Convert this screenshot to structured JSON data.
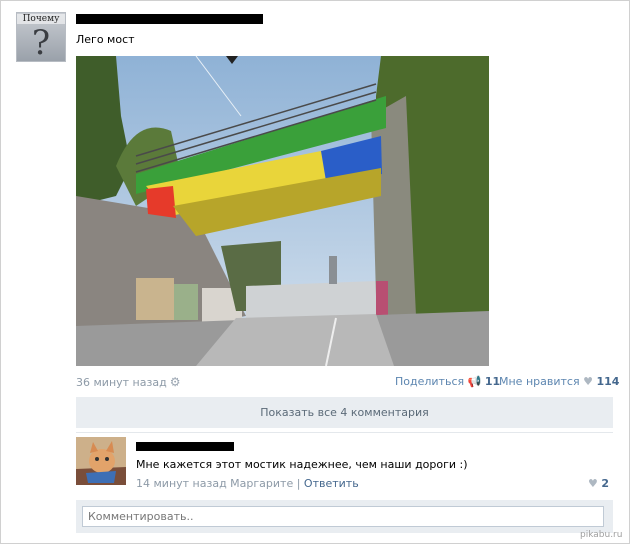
{
  "post": {
    "avatar_caption": "Почему",
    "avatar_symbol": "?",
    "text": "Лего мост",
    "time": "36 минут назад",
    "share_label": "Поделиться",
    "share_count": "11",
    "like_label": "Мне нравится",
    "like_count": "114"
  },
  "comments": {
    "show_all_label": "Показать все 4 комментария",
    "items": [
      {
        "text": "Мне кажется этот мостик надежнее, чем наши дороги :)",
        "time": "14 минут назад Маргарите",
        "reply_label": "Ответить",
        "like_count": "2"
      }
    ],
    "input_placeholder": "Комментировать.."
  },
  "icons": {
    "settings": "gear-icon",
    "share": "megaphone-icon",
    "like": "heart-icon"
  },
  "watermark": "pikabu.ru",
  "colors": {
    "link": "#45688e",
    "muted": "#8d9aa7",
    "panel": "#e9edf1"
  }
}
